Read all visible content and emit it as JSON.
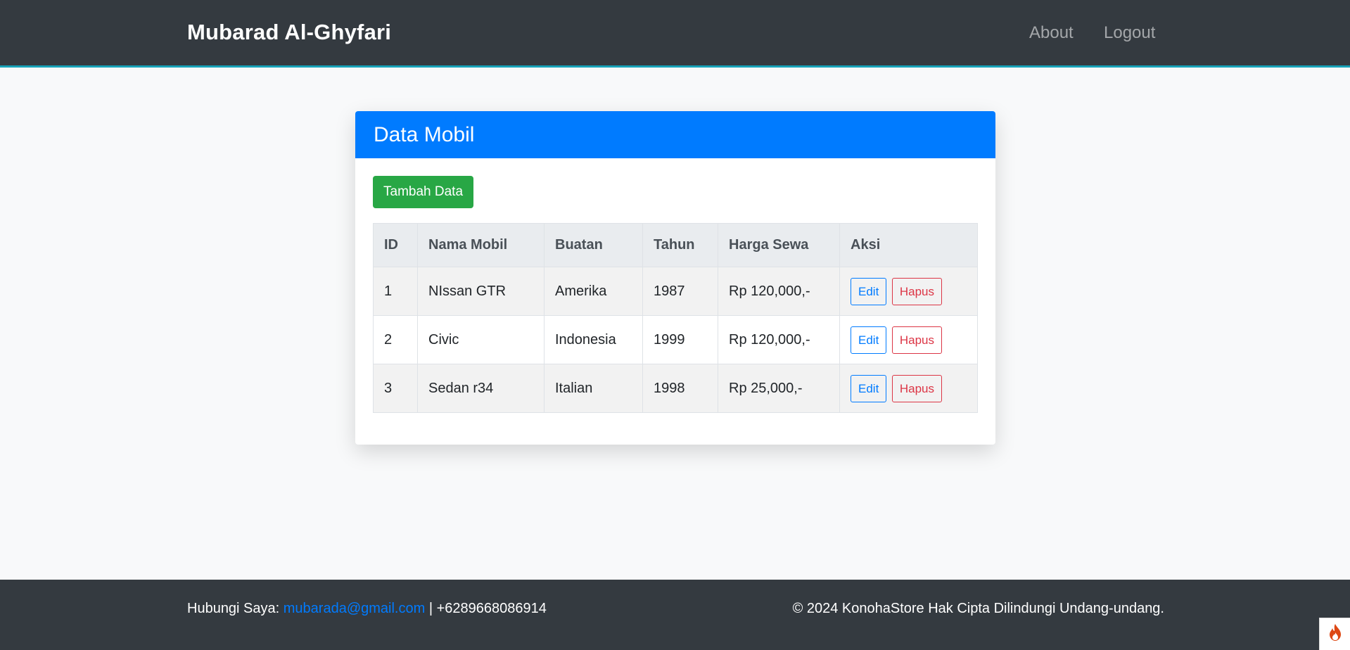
{
  "navbar": {
    "brand": "Mubarad Al-Ghyfari",
    "links": [
      {
        "label": "About"
      },
      {
        "label": "Logout"
      }
    ]
  },
  "card": {
    "title": "Data Mobil",
    "add_button": "Tambah Data",
    "table": {
      "headers": [
        "ID",
        "Nama Mobil",
        "Buatan",
        "Tahun",
        "Harga Sewa",
        "Aksi"
      ],
      "rows": [
        {
          "id": "1",
          "nama": "NIssan GTR",
          "buatan": "Amerika",
          "tahun": "1987",
          "harga": "Rp 120,000,-"
        },
        {
          "id": "2",
          "nama": "Civic",
          "buatan": "Indonesia",
          "tahun": "1999",
          "harga": "Rp 120,000,-"
        },
        {
          "id": "3",
          "nama": "Sedan r34",
          "buatan": "Italian",
          "tahun": "1998",
          "harga": "Rp 25,000,-"
        }
      ],
      "edit_label": "Edit",
      "delete_label": "Hapus"
    }
  },
  "footer": {
    "contact_prefix": "Hubungi Saya:",
    "email": "mubarada@gmail.com",
    "phone": "| +6289668086914",
    "copyright": "© 2024 KonohaStore Hak Cipta Dilindungi Undang-undang."
  },
  "colors": {
    "navbar": "#343a40",
    "accent_line": "#17a2b8",
    "card_header": "#007bff",
    "add_button": "#28a745",
    "edit": "#007bff",
    "delete": "#dc3545"
  },
  "icons": {
    "debug_badge": "flame-icon"
  }
}
